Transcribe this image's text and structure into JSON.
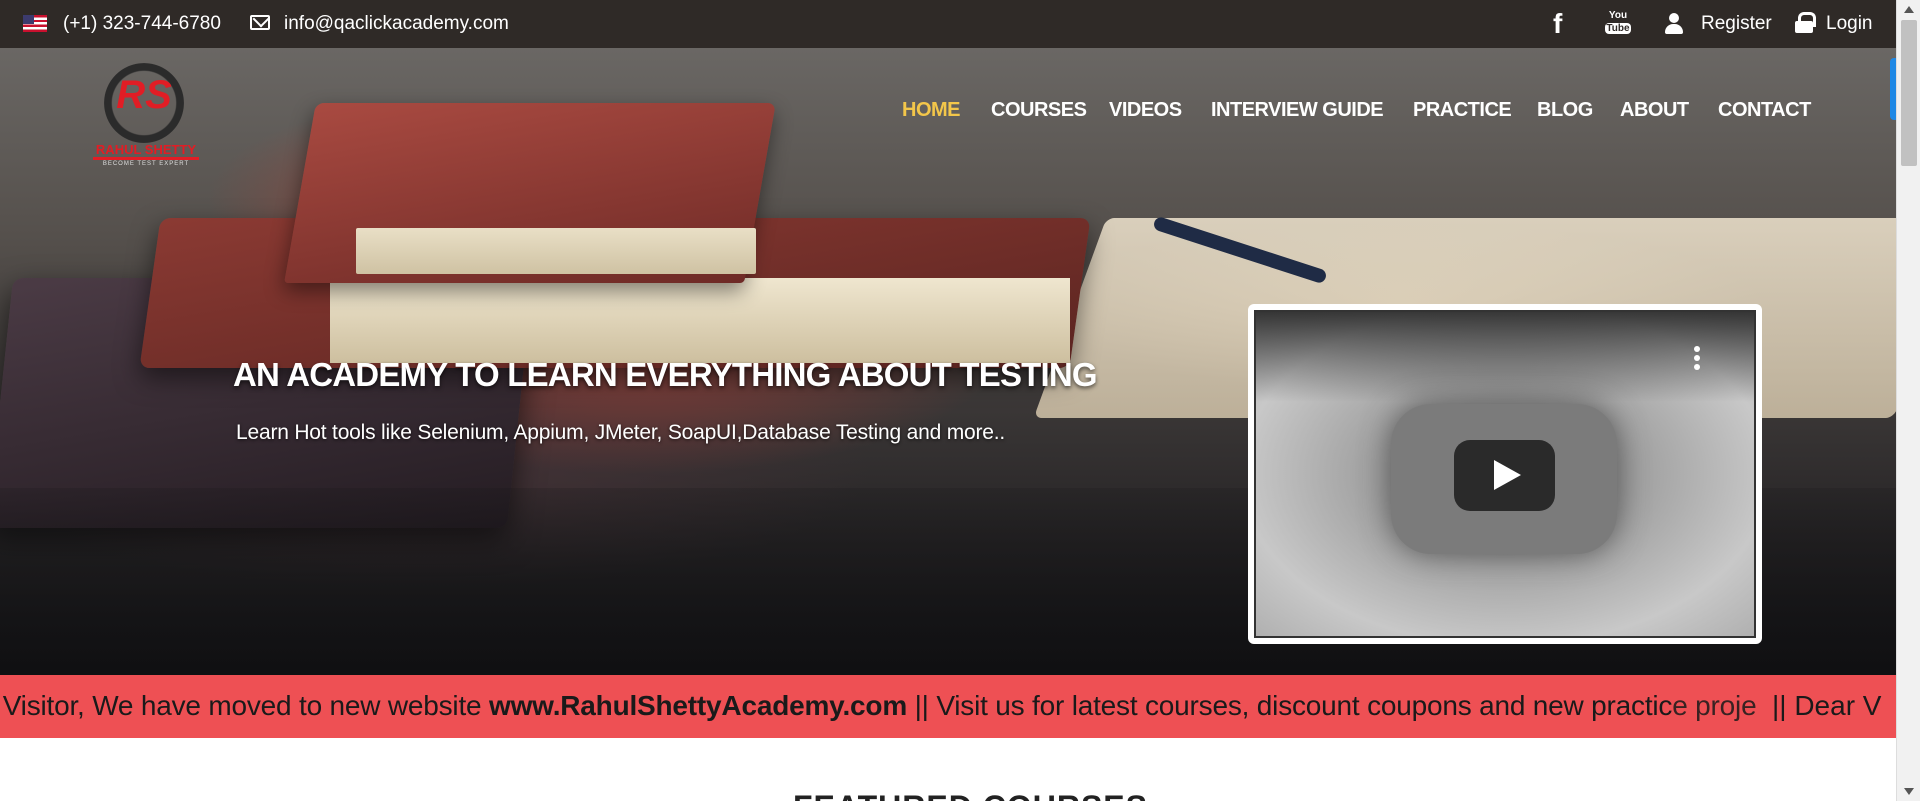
{
  "topbar": {
    "phone": "(+1) 323-744-6780",
    "email": "info@qaclickacademy.com",
    "register": "Register",
    "login": "Login",
    "icons": [
      "us-flag-icon",
      "envelope-icon",
      "facebook-icon",
      "youtube-icon",
      "user-icon",
      "lock-icon"
    ]
  },
  "logo": {
    "initials": "RS",
    "name": "RAHUL SHETTY",
    "tagline": "BECOME TEST EXPERT",
    "color": "#e11d25"
  },
  "nav": {
    "items": [
      {
        "label": "HOME",
        "active": true
      },
      {
        "label": "COURSES"
      },
      {
        "label": "VIDEOS"
      },
      {
        "label": "INTERVIEW GUIDE"
      },
      {
        "label": "PRACTICE"
      },
      {
        "label": "BLOG"
      },
      {
        "label": "ABOUT"
      },
      {
        "label": "CONTACT"
      }
    ],
    "active_color": "#f3c64a"
  },
  "hero": {
    "title": "AN ACADEMY TO LEARN EVERYTHING ABOUT TESTING",
    "subtitle": "Learn Hot tools like Selenium, Appium, JMeter, SoapUI,Database Testing and more.."
  },
  "video": {
    "icons": [
      "play-icon",
      "more-options-icon"
    ]
  },
  "marquee": {
    "prefix": "r Visitor, We have moved to new website ",
    "link": "www.RahulShettyAcademy.com",
    "suffix": " || Visit us for latest courses, discount coupons and new practic",
    "repeat": "|| Dear V",
    "overlap": "e proje",
    "background": "#ee5054"
  },
  "section": {
    "featured_title": "FEATURED COURSES"
  }
}
